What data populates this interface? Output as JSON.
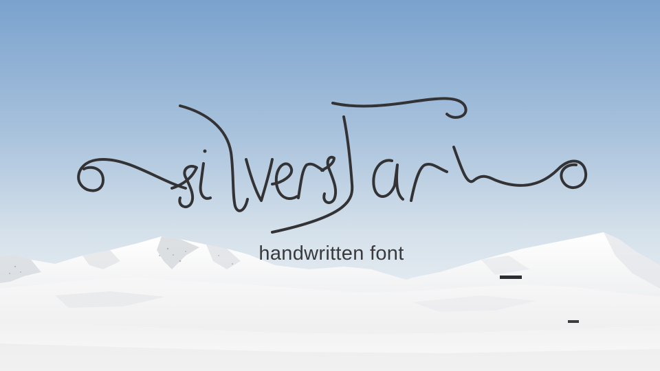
{
  "logo": {
    "text": "silverstar",
    "ink_color": "#333335"
  },
  "subtitle": {
    "text": "handwritten font"
  },
  "scene": {
    "sky_top_color": "#7fa6d0",
    "sky_bottom_color": "#e2eaf1",
    "snow_color": "#f3f3f3"
  }
}
